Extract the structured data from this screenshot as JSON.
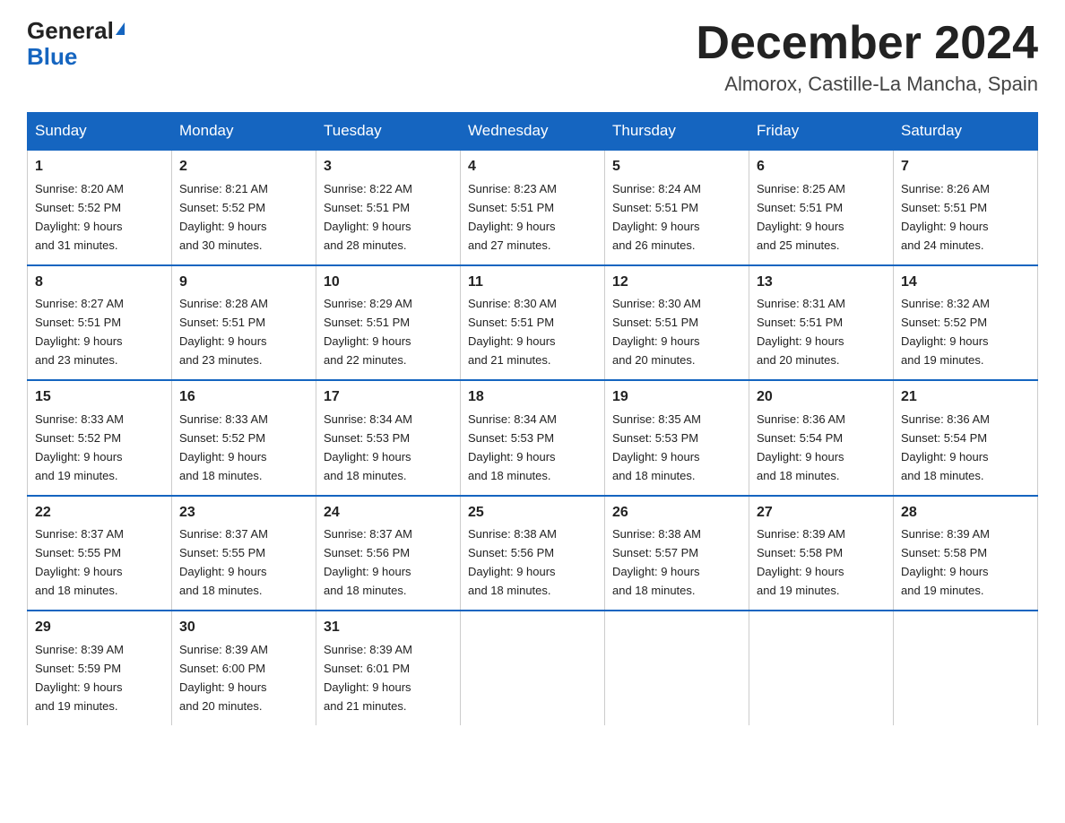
{
  "header": {
    "logo_general": "General",
    "logo_blue": "Blue",
    "month_title": "December 2024",
    "location": "Almorox, Castille-La Mancha, Spain"
  },
  "weekdays": [
    "Sunday",
    "Monday",
    "Tuesday",
    "Wednesday",
    "Thursday",
    "Friday",
    "Saturday"
  ],
  "weeks": [
    [
      {
        "day": "1",
        "sunrise": "8:20 AM",
        "sunset": "5:52 PM",
        "daylight": "9 hours and 31 minutes."
      },
      {
        "day": "2",
        "sunrise": "8:21 AM",
        "sunset": "5:52 PM",
        "daylight": "9 hours and 30 minutes."
      },
      {
        "day": "3",
        "sunrise": "8:22 AM",
        "sunset": "5:51 PM",
        "daylight": "9 hours and 28 minutes."
      },
      {
        "day": "4",
        "sunrise": "8:23 AM",
        "sunset": "5:51 PM",
        "daylight": "9 hours and 27 minutes."
      },
      {
        "day": "5",
        "sunrise": "8:24 AM",
        "sunset": "5:51 PM",
        "daylight": "9 hours and 26 minutes."
      },
      {
        "day": "6",
        "sunrise": "8:25 AM",
        "sunset": "5:51 PM",
        "daylight": "9 hours and 25 minutes."
      },
      {
        "day": "7",
        "sunrise": "8:26 AM",
        "sunset": "5:51 PM",
        "daylight": "9 hours and 24 minutes."
      }
    ],
    [
      {
        "day": "8",
        "sunrise": "8:27 AM",
        "sunset": "5:51 PM",
        "daylight": "9 hours and 23 minutes."
      },
      {
        "day": "9",
        "sunrise": "8:28 AM",
        "sunset": "5:51 PM",
        "daylight": "9 hours and 23 minutes."
      },
      {
        "day": "10",
        "sunrise": "8:29 AM",
        "sunset": "5:51 PM",
        "daylight": "9 hours and 22 minutes."
      },
      {
        "day": "11",
        "sunrise": "8:30 AM",
        "sunset": "5:51 PM",
        "daylight": "9 hours and 21 minutes."
      },
      {
        "day": "12",
        "sunrise": "8:30 AM",
        "sunset": "5:51 PM",
        "daylight": "9 hours and 20 minutes."
      },
      {
        "day": "13",
        "sunrise": "8:31 AM",
        "sunset": "5:51 PM",
        "daylight": "9 hours and 20 minutes."
      },
      {
        "day": "14",
        "sunrise": "8:32 AM",
        "sunset": "5:52 PM",
        "daylight": "9 hours and 19 minutes."
      }
    ],
    [
      {
        "day": "15",
        "sunrise": "8:33 AM",
        "sunset": "5:52 PM",
        "daylight": "9 hours and 19 minutes."
      },
      {
        "day": "16",
        "sunrise": "8:33 AM",
        "sunset": "5:52 PM",
        "daylight": "9 hours and 18 minutes."
      },
      {
        "day": "17",
        "sunrise": "8:34 AM",
        "sunset": "5:53 PM",
        "daylight": "9 hours and 18 minutes."
      },
      {
        "day": "18",
        "sunrise": "8:34 AM",
        "sunset": "5:53 PM",
        "daylight": "9 hours and 18 minutes."
      },
      {
        "day": "19",
        "sunrise": "8:35 AM",
        "sunset": "5:53 PM",
        "daylight": "9 hours and 18 minutes."
      },
      {
        "day": "20",
        "sunrise": "8:36 AM",
        "sunset": "5:54 PM",
        "daylight": "9 hours and 18 minutes."
      },
      {
        "day": "21",
        "sunrise": "8:36 AM",
        "sunset": "5:54 PM",
        "daylight": "9 hours and 18 minutes."
      }
    ],
    [
      {
        "day": "22",
        "sunrise": "8:37 AM",
        "sunset": "5:55 PM",
        "daylight": "9 hours and 18 minutes."
      },
      {
        "day": "23",
        "sunrise": "8:37 AM",
        "sunset": "5:55 PM",
        "daylight": "9 hours and 18 minutes."
      },
      {
        "day": "24",
        "sunrise": "8:37 AM",
        "sunset": "5:56 PM",
        "daylight": "9 hours and 18 minutes."
      },
      {
        "day": "25",
        "sunrise": "8:38 AM",
        "sunset": "5:56 PM",
        "daylight": "9 hours and 18 minutes."
      },
      {
        "day": "26",
        "sunrise": "8:38 AM",
        "sunset": "5:57 PM",
        "daylight": "9 hours and 18 minutes."
      },
      {
        "day": "27",
        "sunrise": "8:39 AM",
        "sunset": "5:58 PM",
        "daylight": "9 hours and 19 minutes."
      },
      {
        "day": "28",
        "sunrise": "8:39 AM",
        "sunset": "5:58 PM",
        "daylight": "9 hours and 19 minutes."
      }
    ],
    [
      {
        "day": "29",
        "sunrise": "8:39 AM",
        "sunset": "5:59 PM",
        "daylight": "9 hours and 19 minutes."
      },
      {
        "day": "30",
        "sunrise": "8:39 AM",
        "sunset": "6:00 PM",
        "daylight": "9 hours and 20 minutes."
      },
      {
        "day": "31",
        "sunrise": "8:39 AM",
        "sunset": "6:01 PM",
        "daylight": "9 hours and 21 minutes."
      },
      null,
      null,
      null,
      null
    ]
  ],
  "labels": {
    "sunrise": "Sunrise:",
    "sunset": "Sunset:",
    "daylight": "Daylight:"
  }
}
